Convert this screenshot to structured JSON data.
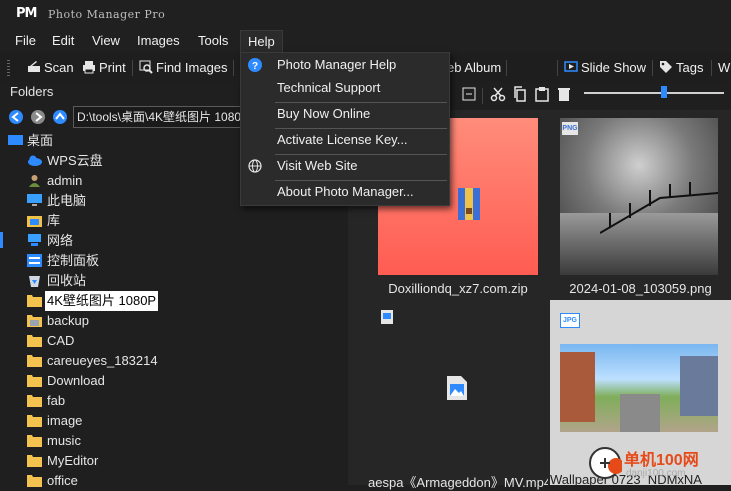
{
  "app": {
    "logo": "PM",
    "title": "Photo Manager Pro"
  },
  "menubar": {
    "file": "File",
    "edit": "Edit",
    "view": "View",
    "images": "Images",
    "tools": "Tools",
    "help": "Help"
  },
  "toolbar": {
    "scan": "Scan",
    "print": "Print",
    "find_images": "Find Images",
    "web_album": "eb Album",
    "slide_show": "Slide Show",
    "tags": "Tags",
    "overflow": "W"
  },
  "folders_panel": {
    "title": "Folders",
    "path": "D:\\tools\\桌面\\4K壁纸图片 1080"
  },
  "tree": [
    {
      "label": "桌面",
      "icon": "desktop-icon"
    },
    {
      "label": "WPS云盘",
      "icon": "cloud-icon"
    },
    {
      "label": "admin",
      "icon": "user-icon"
    },
    {
      "label": "此电脑",
      "icon": "computer-icon"
    },
    {
      "label": "库",
      "icon": "library-icon"
    },
    {
      "label": "网络",
      "icon": "network-icon"
    },
    {
      "label": "控制面板",
      "icon": "control-panel-icon"
    },
    {
      "label": "回收站",
      "icon": "recycle-bin-icon"
    },
    {
      "label": "4K壁纸图片 1080P",
      "icon": "folder-icon"
    },
    {
      "label": "backup",
      "icon": "folder-icon"
    },
    {
      "label": "CAD",
      "icon": "folder-icon"
    },
    {
      "label": "careueyes_183214",
      "icon": "folder-icon"
    },
    {
      "label": "Download",
      "icon": "folder-icon"
    },
    {
      "label": "fab",
      "icon": "folder-icon"
    },
    {
      "label": "image",
      "icon": "folder-icon"
    },
    {
      "label": "music",
      "icon": "folder-icon"
    },
    {
      "label": "MyEditor",
      "icon": "folder-icon"
    },
    {
      "label": "office",
      "icon": "folder-icon"
    }
  ],
  "help_menu": {
    "items": [
      {
        "label": "Photo Manager Help",
        "icon": "help-icon"
      },
      {
        "label": "Technical Support"
      },
      {
        "label": "Buy Now Online"
      },
      {
        "label": "Activate License Key..."
      },
      {
        "label": "Visit Web Site",
        "icon": "globe-icon"
      },
      {
        "label": "About Photo Manager..."
      }
    ]
  },
  "thumbnails": [
    {
      "name": "Doxilliondq_xz7.com.zip",
      "badge": ""
    },
    {
      "name": "2024-01-08_103059.png",
      "badge": "PNG"
    },
    {
      "name": "aespa《Armageddon》MV.mp4",
      "badge": ""
    },
    {
      "name": "Wallpaper 0723_NDMxNA",
      "badge": "JPG"
    }
  ],
  "watermark": {
    "text": "单机100网",
    "url": "danji100.com"
  },
  "colors": {
    "accent": "#2e8bff",
    "background": "#1f1f1f",
    "menu_bg": "#2b2b2b",
    "selection": "#ffffff"
  }
}
